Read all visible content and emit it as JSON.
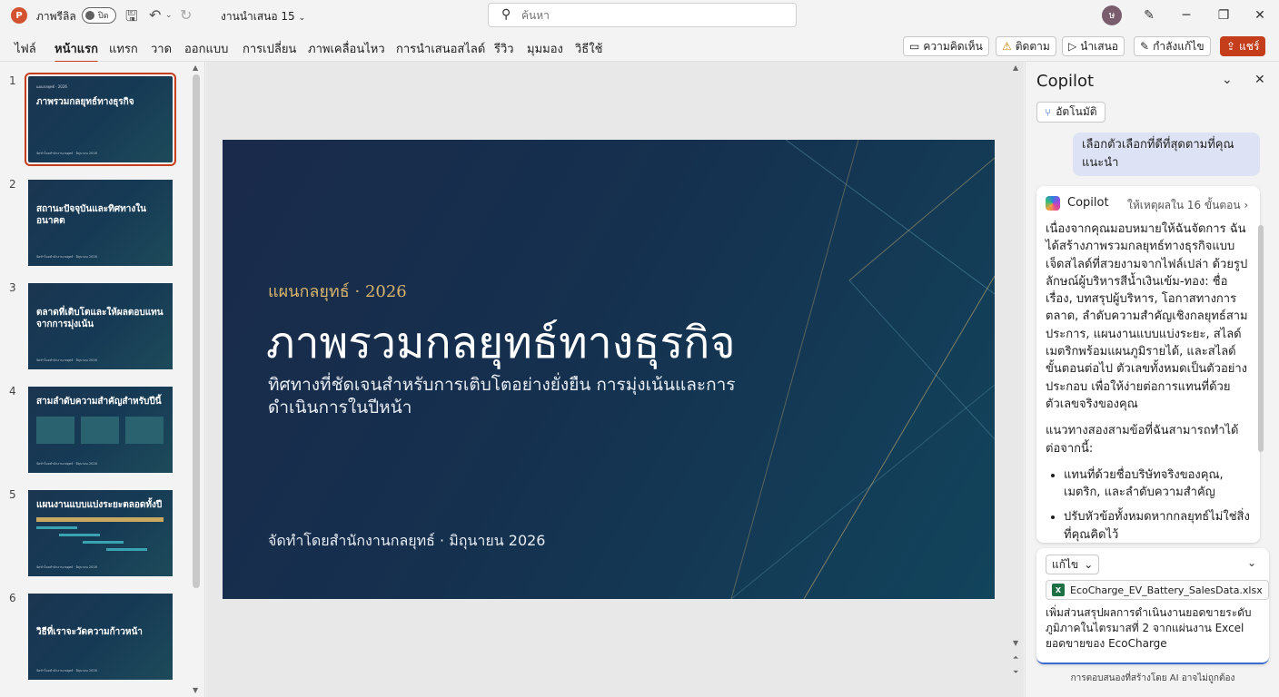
{
  "titlebar": {
    "app_logo": "P",
    "autosave_label": "ภาพรีลิล",
    "autosave_toggle_text": "ปิด",
    "document_title": "งานนำเสนอ 15",
    "search_placeholder": "ค้นหา",
    "avatar_initial": "ษ"
  },
  "ribbon": {
    "tabs": [
      "ไฟล์",
      "หน้าแรก",
      "แทรก",
      "วาด",
      "ออกแบบ",
      "การเปลี่ยน",
      "ภาพเคลื่อนไหว",
      "การนำเสนอสไลด์",
      "รีวิว",
      "มุมมอง",
      "วิธีใช้"
    ],
    "active_tab": "หน้าแรก",
    "buttons": {
      "comments": "ความคิดเห็น",
      "follow": "ติดตาม",
      "present": "นำเสนอ",
      "editing": "กำลังแก้ไข",
      "share": "แชร์"
    },
    "accent_color": "#c43e1c"
  },
  "thumbnails": [
    {
      "num": "1",
      "title": "ภาพรวมกลยุทธ์ทางธุรกิจ",
      "small": "แผนกลยุทธ์ · 2026",
      "foot": "จัดทำโดยสำนักงานกลยุทธ์ · มิถุนายน 2026",
      "selected": true
    },
    {
      "num": "2",
      "title": "สถานะปัจจุบันและทิศทางในอนาคต",
      "small": "",
      "foot": "จัดทำโดยสำนักงานกลยุทธ์ · มิถุนายน 2026",
      "selected": false
    },
    {
      "num": "3",
      "title": "ตลาดที่เติบโตและให้ผลตอบแทนจากการมุ่งเน้น",
      "small": "",
      "foot": "จัดทำโดยสำนักงานกลยุทธ์ · มิถุนายน 2026",
      "selected": false
    },
    {
      "num": "4",
      "title": "สามลำดับความสำคัญสำหรับปีนี้",
      "small": "",
      "foot": "จัดทำโดยสำนักงานกลยุทธ์ · มิถุนายน 2026",
      "selected": false
    },
    {
      "num": "5",
      "title": "แผนงานแบบแบ่งระยะตลอดทั้งปี",
      "small": "",
      "foot": "จัดทำโดยสำนักงานกลยุทธ์ · มิถุนายน 2026",
      "selected": false
    },
    {
      "num": "6",
      "title": "วิธีที่เราจะวัดความก้าวหน้า",
      "small": "",
      "foot": "จัดทำโดยสำนักงานกลยุทธ์ · มิถุนายน 2026",
      "selected": false
    }
  ],
  "slide": {
    "kicker": "แผนกลยุทธ์ · 2026",
    "title": "ภาพรวมกลยุทธ์ทางธุรกิจ",
    "subtitle": "ทิศทางที่ชัดเจนสำหรับการเติบโตอย่างยั่งยืน การมุ่งเน้นและการดำเนินการในปีหน้า",
    "footer": "จัดทำโดยสำนักงานกลยุทธ์ · มิถุนายน 2026",
    "gold_color": "#d9b56a"
  },
  "copilot": {
    "title": "Copilot",
    "auto_button": "อัตโนมัติ",
    "user_message": "เลือกตัวเลือกที่ดีที่สุดตามที่คุณแนะนำ",
    "response_name": "Copilot",
    "response_steps": "ให้เหตุผลใน 16 ขั้นตอน",
    "response_p1": "เนื่องจากคุณมอบหมายให้ฉันจัดการ ฉันได้สร้างภาพรวมกลยุทธ์ทางธุรกิจแบบเจ็ดสไลด์ที่สวยงามจากไฟล์เปล่า ด้วยรูปลักษณ์ผู้บริหารสีน้ำเงินเข้ม-ทอง: ชื่อเรื่อง, บทสรุปผู้บริหาร, โอกาสทางการตลาด, ลำดับความสำคัญเชิงกลยุทธ์สามประการ, แผนงานแบบแบ่งระยะ, สไลด์เมตริกพร้อมแผนภูมิรายได้, และสไลด์ขั้นตอนต่อไป ตัวเลขทั้งหมดเป็นตัวอย่างประกอบ เพื่อให้ง่ายต่อการแทนที่ด้วยตัวเลขจริงของคุณ",
    "response_p2": "แนวทางสองสามข้อที่ฉันสามารถทำได้ต่อจากนี้:",
    "response_bullets": [
      "แทนที่ด้วยชื่อบริษัทจริงของคุณ, เมตริก, และลำดับความสำคัญ",
      "ปรับหัวข้อทั้งหมดหากกลยุทธ์ไม่ใช่สิ่งที่คุณคิดไว้"
    ],
    "compose_mode": "แก้ไข",
    "attached_file": "EcoCharge_EV_Battery_SalesData.xlsx",
    "prompt_text": "เพิ่มส่วนสรุปผลการดำเนินงานยอดขายระดับภูมิภาคในไตรมาสที่ 2 จากแผ่นงาน Excel ยอดขายของ EcoCharge",
    "disclaimer": "การตอบสนองที่สร้างโดย AI อาจไม่ถูกต้อง"
  }
}
